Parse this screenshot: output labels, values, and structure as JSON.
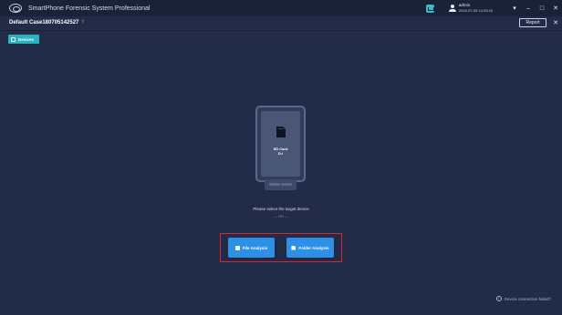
{
  "titlebar": {
    "app_title": "SmartPhone Forensic System Professional",
    "user_name": "admin",
    "user_time": "2018-07-05 14:29:43",
    "minimize": "–",
    "maximize": "□",
    "close": "✕",
    "dropdown": "▾"
  },
  "case": {
    "title": "Default Case180705142527",
    "info_mark": "?",
    "report_label": "Report",
    "close": "✕"
  },
  "devices_tab": {
    "label": "Devices"
  },
  "device": {
    "line1": "SD Card",
    "line2": "D:\\"
  },
  "prompt": {
    "text": "Please select the target device",
    "or_text": "— OR —"
  },
  "actions": {
    "file_analysis": "File Analysis",
    "folder_analysis": "Folder Analysis"
  },
  "status": {
    "info_glyph": "i",
    "text": "Device connection failed?"
  },
  "colors": {
    "background": "#222b47",
    "titlebar": "#1a2238",
    "accent_teal": "#2bb1bf",
    "button_blue": "#2e8fe6",
    "highlight_red": "#d6262f"
  }
}
